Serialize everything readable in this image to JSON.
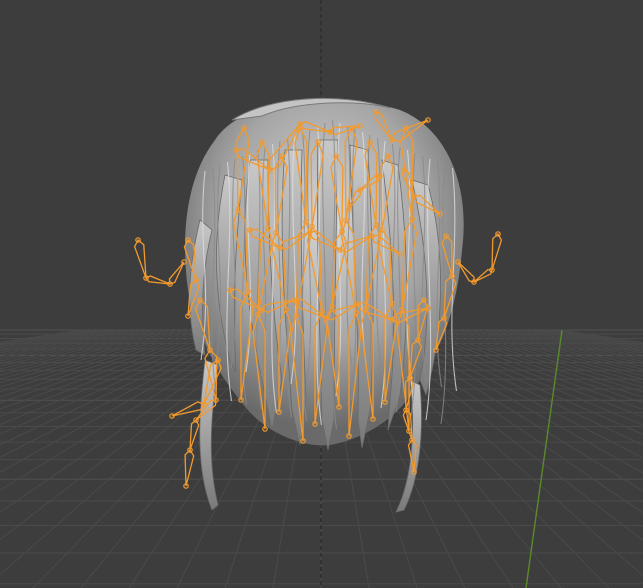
{
  "viewport": {
    "background_color": "#3d3d3d",
    "grid_color": "#4a4a4a",
    "grid_major_color": "#525252",
    "y_axis_color": "#5a8a2a",
    "z_axis_color": "#2a2a2a",
    "mesh_color": "#b4b4b4",
    "mesh_shadow_color": "#6a6a6a",
    "armature_color": "#f29a2e",
    "armature_outline_color": "#c66f0f"
  },
  "scene": {
    "object": "hair-mesh",
    "overlay": "armature-bones",
    "view": "perspective-front"
  }
}
